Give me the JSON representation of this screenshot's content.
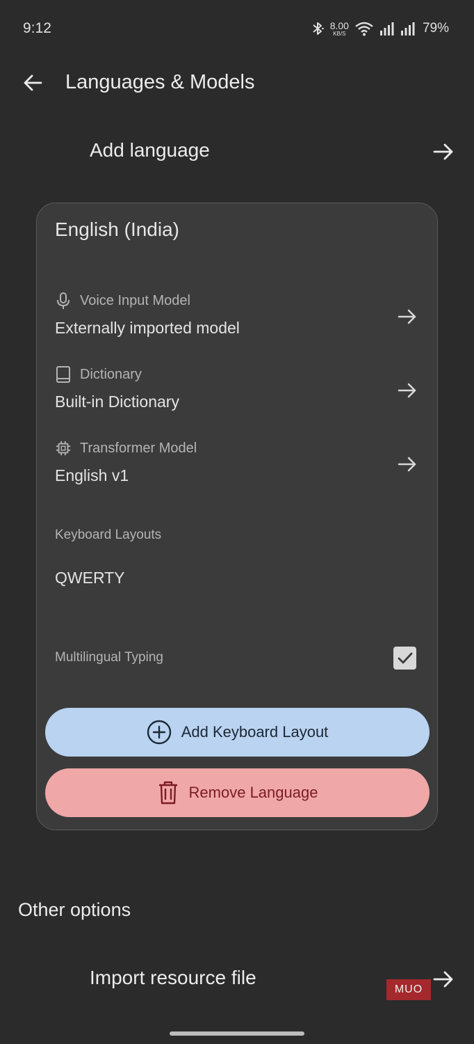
{
  "status_bar": {
    "time": "9:12",
    "net_speed_value": "8.00",
    "net_speed_unit": "KB/S",
    "battery": "79%",
    "icons": [
      "bluetooth-icon",
      "wifi-icon",
      "signal-icon",
      "signal-icon"
    ]
  },
  "app_bar": {
    "title": "Languages & Models",
    "back_icon": "arrow-left-icon"
  },
  "add_language": {
    "label": "Add language",
    "icon": "arrow-right-icon"
  },
  "language_card": {
    "title": "English (India)",
    "voice_input": {
      "caption": "Voice Input Model",
      "value": "Externally imported model",
      "icon": "microphone-icon"
    },
    "dictionary": {
      "caption": "Dictionary",
      "value": "Built-in Dictionary",
      "icon": "book-icon"
    },
    "transformer": {
      "caption": "Transformer Model",
      "value": "English v1",
      "icon": "chip-icon"
    },
    "keyboard_layouts": {
      "label": "Keyboard Layouts",
      "items": [
        "QWERTY"
      ]
    },
    "multilingual": {
      "label": "Multilingual Typing",
      "checked": true
    },
    "add_layout_button": {
      "label": "Add Keyboard Layout",
      "icon": "add-circle-icon",
      "color": "#b9d3f0"
    },
    "remove_language_button": {
      "label": "Remove Language",
      "icon": "trash-icon",
      "color": "#f0a7a7"
    }
  },
  "other_options": {
    "title": "Other options",
    "import_resource": {
      "label": "Import resource file",
      "icon": "arrow-right-icon"
    }
  },
  "watermark": {
    "text": "MUO",
    "color": "#a5282c"
  },
  "theme": {
    "background": "#2b2b2b",
    "card": "#3b3b3b"
  }
}
